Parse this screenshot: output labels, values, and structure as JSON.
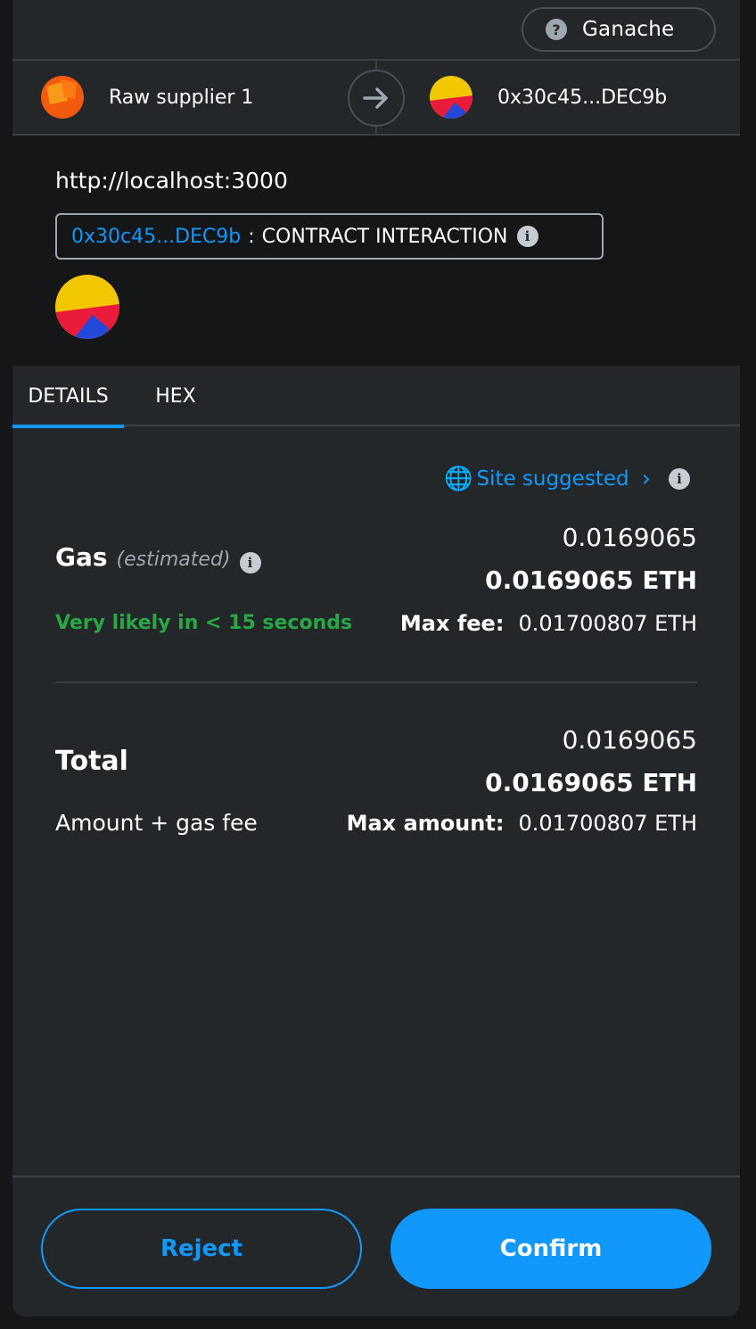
{
  "network": {
    "name": "Ganache",
    "icon": "question-icon"
  },
  "accounts": {
    "from_label": "Raw supplier 1",
    "to_label": "0x30c45...DEC9b"
  },
  "site": {
    "origin": "http://localhost:3000",
    "contract_address": "0x30c45...DEC9b",
    "separator": ":",
    "interaction_type": "CONTRACT INTERACTION"
  },
  "tabs": [
    {
      "label": "DETAILS",
      "active": true
    },
    {
      "label": "HEX",
      "active": false
    }
  ],
  "details": {
    "suggested_label": "Site suggested",
    "gas": {
      "title": "Gas",
      "estimated": "(estimated)",
      "time": "Very likely in < 15 seconds",
      "value": "0.0169065",
      "value_eth": "0.0169065 ETH",
      "max_label": "Max fee:",
      "max_value": "0.01700807 ETH"
    },
    "total": {
      "title": "Total",
      "subtitle": "Amount + gas fee",
      "value": "0.0169065",
      "value_eth": "0.0169065 ETH",
      "max_label": "Max amount:",
      "max_value": "0.01700807 ETH"
    }
  },
  "footer": {
    "reject_label": "Reject",
    "confirm_label": "Confirm"
  },
  "colors": {
    "accent": "#1098fc",
    "success": "#28a745",
    "background": "#24272a"
  }
}
